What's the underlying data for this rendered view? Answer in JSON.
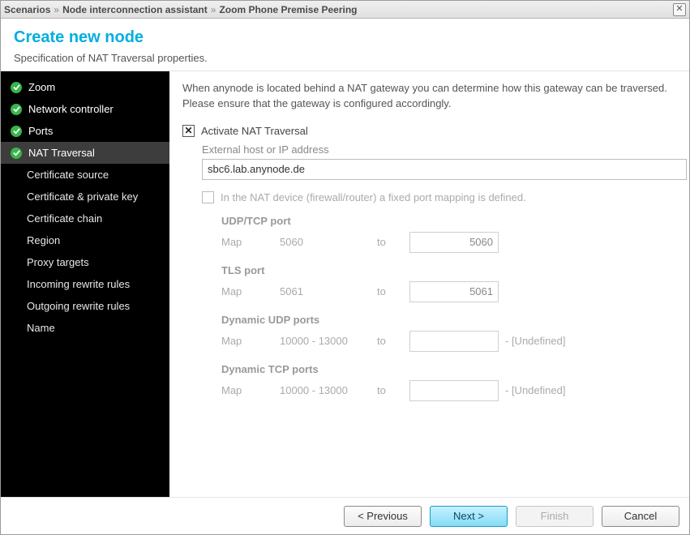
{
  "breadcrumb": {
    "root": "Scenarios",
    "mid": "Node interconnection assistant",
    "leaf": "Zoom Phone Premise Peering"
  },
  "header": {
    "title": "Create new node",
    "subtitle": "Specification of NAT Traversal properties."
  },
  "sidebar": {
    "items": [
      {
        "label": "Zoom",
        "done": true,
        "active": false
      },
      {
        "label": "Network controller",
        "done": true,
        "active": false
      },
      {
        "label": "Ports",
        "done": true,
        "active": false
      },
      {
        "label": "NAT Traversal",
        "done": true,
        "active": true
      },
      {
        "label": "Certificate source",
        "done": false
      },
      {
        "label": "Certificate & private key",
        "done": false
      },
      {
        "label": "Certificate chain",
        "done": false
      },
      {
        "label": "Region",
        "done": false
      },
      {
        "label": "Proxy targets",
        "done": false
      },
      {
        "label": "Incoming rewrite rules",
        "done": false
      },
      {
        "label": "Outgoing rewrite rules",
        "done": false
      },
      {
        "label": "Name",
        "done": false
      }
    ]
  },
  "content": {
    "intro": "When anynode is located behind a NAT gateway you can determine how this gateway can be traversed. Please ensure that the gateway is configured accordingly.",
    "activate_label": "Activate NAT Traversal",
    "activate_checked": true,
    "external_host_label": "External host or IP address",
    "external_host_value": "sbc6.lab.anynode.de",
    "fixed_mapping_label": "In the NAT device (firewall/router) a fixed port mapping is defined.",
    "fixed_mapping_checked": false,
    "map_label": "Map",
    "to_label": "to",
    "undefined_label": "- [Undefined]",
    "ports": {
      "udptcp": {
        "title": "UDP/TCP port",
        "src": "5060",
        "dst": "5060"
      },
      "tls": {
        "title": "TLS port",
        "src": "5061",
        "dst": "5061"
      },
      "dynudp": {
        "title": "Dynamic UDP ports",
        "src": "10000 - 13000",
        "dst": ""
      },
      "dyntcp": {
        "title": "Dynamic TCP ports",
        "src": "10000 - 13000",
        "dst": ""
      }
    }
  },
  "footer": {
    "previous": "< Previous",
    "next": "Next >",
    "finish": "Finish",
    "cancel": "Cancel"
  }
}
